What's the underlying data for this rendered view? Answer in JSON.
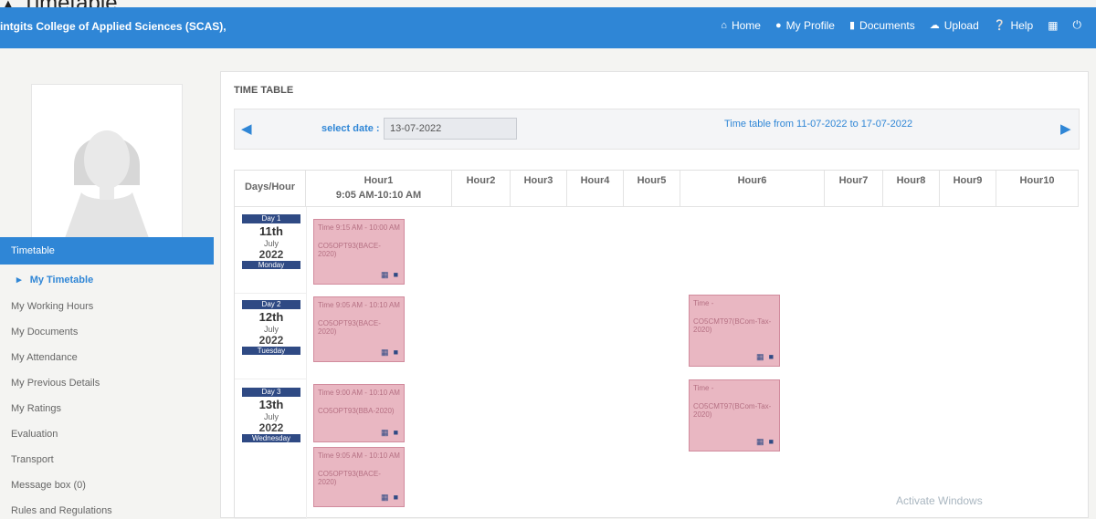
{
  "app_title": "Timetable",
  "topbar": {
    "college": "intgits College of Applied Sciences (SCAS),",
    "nav": [
      {
        "label": "Home",
        "icon": "home-icon"
      },
      {
        "label": "My Profile",
        "icon": "user-icon"
      },
      {
        "label": "Documents",
        "icon": "document-icon"
      },
      {
        "label": "Upload",
        "icon": "upload-icon"
      },
      {
        "label": "Help",
        "icon": "help-icon"
      }
    ]
  },
  "sidebar": {
    "active": "Timetable",
    "sub_active": "My Timetable",
    "items": [
      "My Working Hours",
      "My Documents",
      "My Attendance",
      "My Previous Details",
      "My Ratings",
      "Evaluation",
      "Transport",
      "Message box (0)",
      "Rules and Regulations"
    ]
  },
  "main": {
    "title": "TIME TABLE",
    "select_date_label": "select date :",
    "date_value": "13-07-2022",
    "range_text": "Time table from 11-07-2022 to 17-07-2022",
    "header": {
      "days": "Days/Hour",
      "hour1": "Hour1",
      "hour1_time": "9:05 AM-10:10 AM",
      "hours": [
        "Hour2",
        "Hour3",
        "Hour4",
        "Hour5",
        "Hour6",
        "Hour7",
        "Hour8",
        "Hour9",
        "Hour10"
      ]
    },
    "days": [
      {
        "badge": "Day 1",
        "date": "11th",
        "month": "July",
        "year": "2022",
        "weekday": "Monday"
      },
      {
        "badge": "Day 2",
        "date": "12th",
        "month": "July",
        "year": "2022",
        "weekday": "Tuesday"
      },
      {
        "badge": "Day 3",
        "date": "13th",
        "month": "July",
        "year": "2022",
        "weekday": "Wednesday"
      }
    ],
    "slots": [
      {
        "time": "Time 9:15 AM - 10:00 AM",
        "course": "CO5OPT93(BACE-2020)"
      },
      {
        "time": "Time 9:05 AM - 10:10 AM",
        "course": "CO5OPT93(BACE-2020)"
      },
      {
        "time": "Time -",
        "course": "CO5CMT97(BCom-Tax-2020)"
      },
      {
        "time": "Time 9:00 AM - 10:10 AM",
        "course": "CO5OPT93(BBA-2020)"
      },
      {
        "time": "Time -",
        "course": "CO5CMT97(BCom-Tax-2020)"
      },
      {
        "time": "Time 9:05 AM - 10:10 AM",
        "course": "CO5OPT93(BACE-2020)"
      }
    ]
  },
  "watermark": "Activate Windows"
}
